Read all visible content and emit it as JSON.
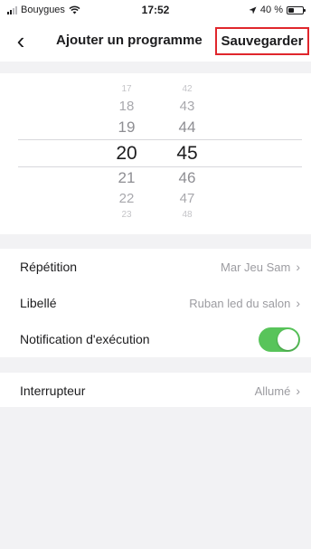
{
  "status_bar": {
    "carrier": "Bouygues",
    "time": "17:52",
    "battery_percent": "40 %",
    "battery_level": 0.4
  },
  "nav": {
    "back_icon": "chevron-left-icon",
    "title": "Ajouter un programme",
    "save_label": "Sauvegarder",
    "highlight_color": "#e0262c"
  },
  "time_picker": {
    "hours": [
      "17",
      "18",
      "19",
      "20",
      "21",
      "22",
      "23"
    ],
    "minutes": [
      "42",
      "43",
      "44",
      "45",
      "46",
      "47",
      "48"
    ],
    "selected_hour": "20",
    "selected_minute": "45"
  },
  "settings": {
    "repetition": {
      "label": "Répétition",
      "value": "Mar Jeu Sam"
    },
    "libelle": {
      "label": "Libellé",
      "value": "Ruban led du salon"
    },
    "notification": {
      "label": "Notification d'exécution",
      "enabled": true,
      "color": "#58c45a"
    },
    "interrupteur": {
      "label": "Interrupteur",
      "value": "Allumé"
    }
  }
}
